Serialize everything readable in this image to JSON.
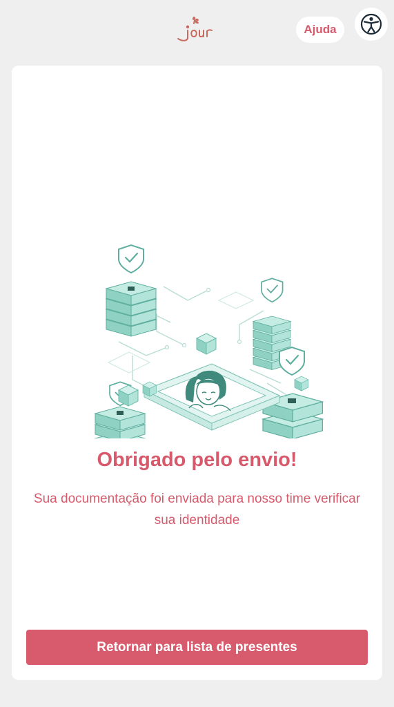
{
  "header": {
    "logo_icon": "le-jour-logo",
    "help_label": "Ajuda",
    "accessibility_icon": "accessibility-icon"
  },
  "confirmation": {
    "illustration_icon": "secure-identity-verification-illustration",
    "title": "Obrigado pelo envio!",
    "message": "Sua documentação foi enviada para nosso time verificar sua identidade"
  },
  "actions": {
    "return_label": "Retornar para lista de presentes"
  },
  "colors": {
    "accent": "#d65a6c",
    "button": "#d85b6d",
    "background": "#efefef",
    "card": "#ffffff",
    "illustration_teal": "#a8ddd2",
    "illustration_dark_teal": "#3f8a7c"
  }
}
